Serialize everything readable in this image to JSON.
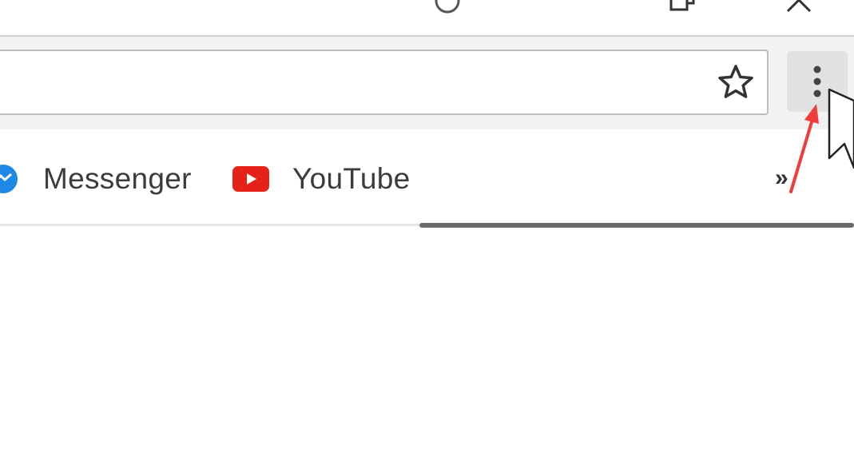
{
  "window": {
    "controls": [
      {
        "name": "profile-icon"
      },
      {
        "name": "restore-icon"
      },
      {
        "name": "close-icon"
      }
    ]
  },
  "toolbar": {
    "omnibox": {
      "value": "",
      "placeholder": ""
    },
    "bookmark_star_icon": "star-outline-icon",
    "menu_icon": "three-dots-vertical-icon"
  },
  "bookmarks_bar": {
    "items": [
      {
        "label": "Messenger",
        "icon": "messenger-icon",
        "color": "#1e88e5"
      },
      {
        "label": "YouTube",
        "icon": "youtube-icon",
        "color": "#e62117"
      }
    ],
    "overflow_label": "»"
  },
  "annotations": {
    "arrow_color": "#f23c3c",
    "cursor_icon": "mouse-pointer-icon"
  }
}
